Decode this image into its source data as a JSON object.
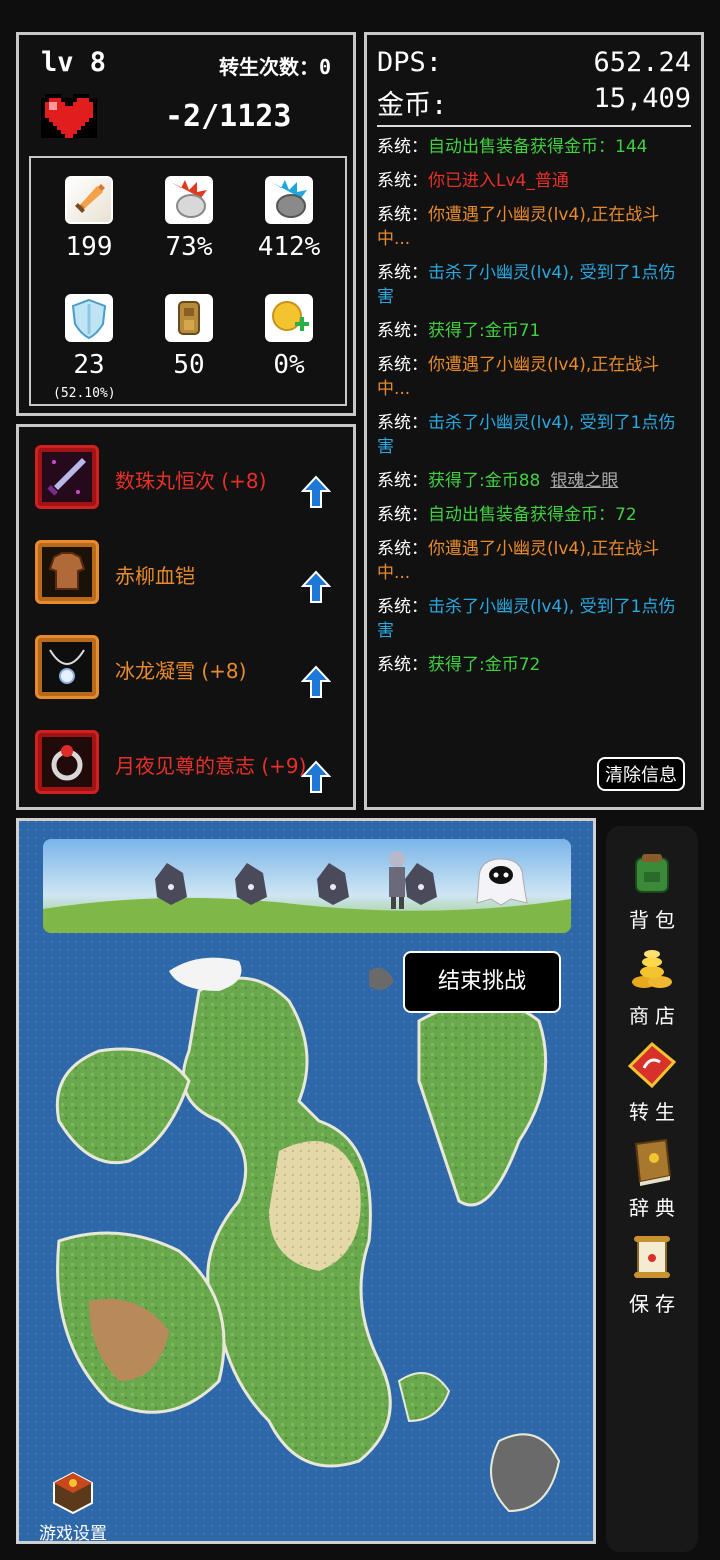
{
  "player": {
    "level": "lv 8",
    "reborn": "转生次数：0",
    "hp": "-2/1123"
  },
  "stats": [
    {
      "icon": "sword-icon",
      "value": "199"
    },
    {
      "icon": "crit-fist-icon",
      "value": "73%"
    },
    {
      "icon": "crit-damage-icon",
      "value": "412%"
    },
    {
      "icon": "shield-icon",
      "value": "23"
    },
    {
      "icon": "armor-icon",
      "value": "50"
    },
    {
      "icon": "gold-bonus-icon",
      "value": "0%"
    }
  ],
  "stat_sub": "(52.10%)",
  "equipment": [
    {
      "name": "数珠丸恒次 (+8)",
      "color": "#e8302a",
      "icon": "weapon-icon"
    },
    {
      "name": "赤柳血铠",
      "color": "#e88a2e",
      "icon": "body-armor-icon"
    },
    {
      "name": "冰龙凝雪 (+8)",
      "color": "#e88a2e",
      "icon": "necklace-icon"
    },
    {
      "name": "月夜见尊的意志 (+9)",
      "color": "#e8302a",
      "icon": "ring-icon"
    }
  ],
  "summary": {
    "dps_label": "DPS:",
    "dps": "652.24",
    "gold_label": "金币:",
    "gold": "15,409"
  },
  "log": [
    {
      "prefix": "系统：",
      "text": "自动出售装备获得金币：144",
      "color": "#40d040"
    },
    {
      "prefix": "系统：",
      "text": "你已进入Lv4_普通",
      "color": "#e8302a"
    },
    {
      "prefix": "系统：",
      "text": "你遭遇了小幽灵(lv4),正在战斗中...",
      "color": "#e88a2e"
    },
    {
      "prefix": "系统：",
      "text": "击杀了小幽灵(lv4), 受到了1点伤害",
      "color": "#2aa8e0"
    },
    {
      "prefix": "系统：",
      "text": "获得了:金币71",
      "color": "#40d040"
    },
    {
      "prefix": "系统：",
      "text": "你遭遇了小幽灵(lv4),正在战斗中...",
      "color": "#e88a2e"
    },
    {
      "prefix": "系统：",
      "text": "击杀了小幽灵(lv4), 受到了1点伤害",
      "color": "#2aa8e0"
    },
    {
      "prefix": "系统：",
      "text": "获得了:金币88",
      "color": "#40d040",
      "extra": "银魂之眼"
    },
    {
      "prefix": "系统：",
      "text": "自动出售装备获得金币：72",
      "color": "#40d040"
    },
    {
      "prefix": "系统：",
      "text": "你遭遇了小幽灵(lv4),正在战斗中...",
      "color": "#e88a2e"
    },
    {
      "prefix": "系统：",
      "text": "击杀了小幽灵(lv4), 受到了1点伤害",
      "color": "#2aa8e0"
    },
    {
      "prefix": "系统：",
      "text": "获得了:金币72",
      "color": "#40d040"
    }
  ],
  "clear_button": "清除信息",
  "end_challenge": "结束挑战",
  "settings_label": "游戏设置",
  "menu": [
    {
      "label": "背包",
      "icon": "backpack-icon"
    },
    {
      "label": "商店",
      "icon": "coins-icon"
    },
    {
      "label": "转生",
      "icon": "reborn-scroll-icon"
    },
    {
      "label": "辞典",
      "icon": "book-icon"
    },
    {
      "label": "保存",
      "icon": "save-scroll-icon"
    }
  ]
}
